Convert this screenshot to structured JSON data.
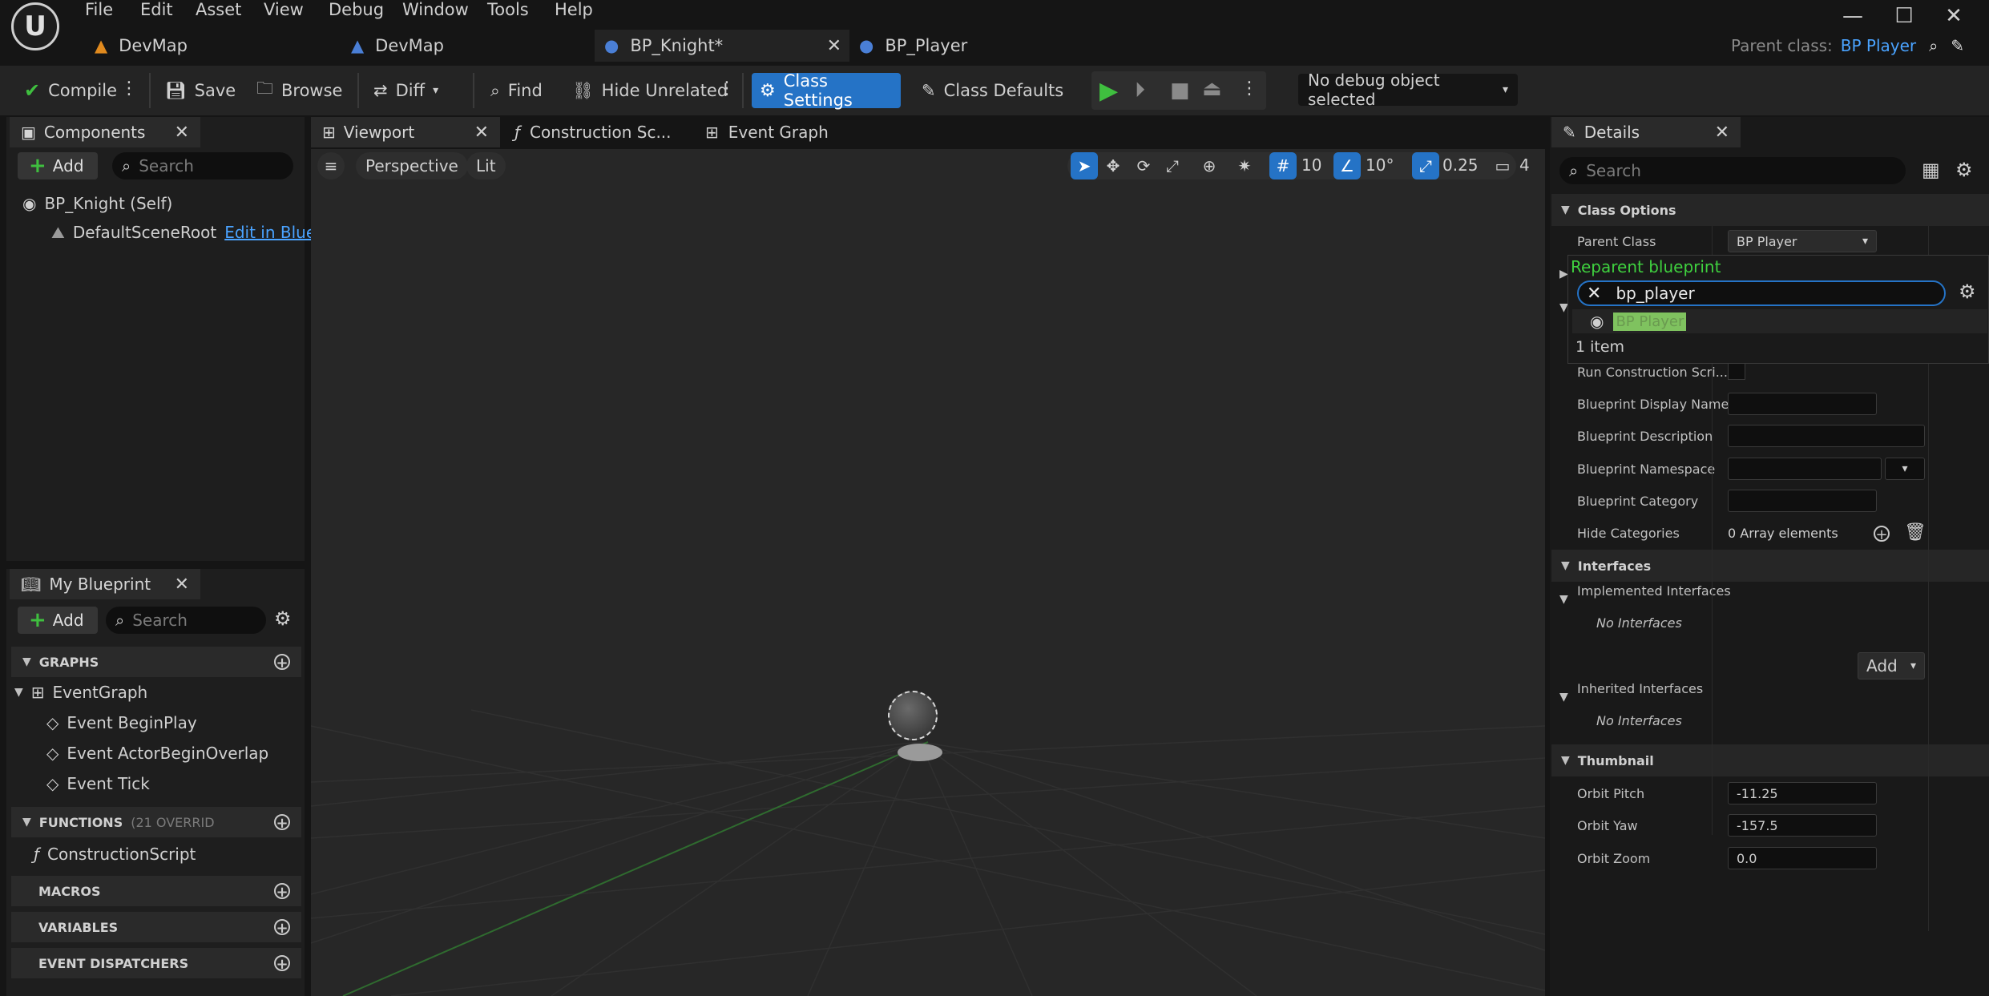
{
  "menu": [
    "File",
    "Edit",
    "Asset",
    "View",
    "Debug",
    "Window",
    "Tools",
    "Help"
  ],
  "doc_tabs": [
    {
      "label": "DevMap",
      "icon": "level-icon"
    },
    {
      "label": "DevMap",
      "icon": "level-icon"
    },
    {
      "label": "BP_Knight*",
      "icon": "blueprint-icon"
    },
    {
      "label": "BP_Player",
      "icon": "blueprint-icon"
    }
  ],
  "parent_class": {
    "label": "Parent class:",
    "value": "BP Player"
  },
  "toolbar": {
    "compile": "Compile",
    "save": "Save",
    "browse": "Browse",
    "diff": "Diff",
    "find": "Find",
    "hide_unrelated": "Hide Unrelated",
    "class_settings": "Class Settings",
    "class_defaults": "Class Defaults",
    "debug_object": "No debug object selected"
  },
  "components": {
    "title": "Components",
    "add": "Add",
    "search_placeholder": "Search",
    "self_item": "BP_Knight (Self)",
    "root_item": "DefaultSceneRoot",
    "edit_link": "Edit in Bluep"
  },
  "my_blueprint": {
    "title": "My Blueprint",
    "add": "Add",
    "search_placeholder": "Search",
    "graphs_header": "GRAPHS",
    "event_graph": "EventGraph",
    "events": [
      "Event BeginPlay",
      "Event ActorBeginOverlap",
      "Event Tick"
    ],
    "functions_header": "FUNCTIONS",
    "functions_override": "(21 OVERRID",
    "construction_script": "ConstructionScript",
    "macros_header": "MACROS",
    "variables_header": "VARIABLES",
    "dispatchers_header": "EVENT DISPATCHERS"
  },
  "editor_tabs": {
    "viewport": "Viewport",
    "construction": "Construction Sc...",
    "event_graph": "Event Graph"
  },
  "viewport": {
    "perspective": "Perspective",
    "lit": "Lit",
    "grid_snap": "10",
    "rotation_snap": "10°",
    "scale_snap": "0.25",
    "camera_speed": "4"
  },
  "details": {
    "title": "Details",
    "search_placeholder": "Search",
    "class_options": "Class Options",
    "parent_class_label": "Parent Class",
    "parent_class_value": "BP Player",
    "reparent_title": "Reparent blueprint",
    "reparent_query": "bp_player",
    "reparent_result": "BP Player",
    "reparent_count": "1 item",
    "run_construction_label": "Run Construction Scri...",
    "display_name_label": "Blueprint Display Name",
    "description_label": "Blueprint Description",
    "namespace_label": "Blueprint Namespace",
    "category_label": "Blueprint Category",
    "hide_categories_label": "Hide Categories",
    "hide_categories_value": "0 Array elements",
    "interfaces_header": "Interfaces",
    "implemented_label": "Implemented Interfaces",
    "implemented_value": "No Interfaces",
    "add_button": "Add",
    "inherited_label": "Inherited Interfaces",
    "inherited_value": "No Interfaces",
    "thumbnail_header": "Thumbnail",
    "orbit_pitch_label": "Orbit Pitch",
    "orbit_pitch_value": "-11.25",
    "orbit_yaw_label": "Orbit Yaw",
    "orbit_yaw_value": "-157.5",
    "orbit_zoom_label": "Orbit Zoom",
    "orbit_zoom_value": "0.0"
  },
  "colors": {
    "accent_blue": "#2573c6",
    "link_blue": "#4aa3ff",
    "reparent_green": "#3fd13f",
    "highlight_green": "#7fc25f"
  }
}
